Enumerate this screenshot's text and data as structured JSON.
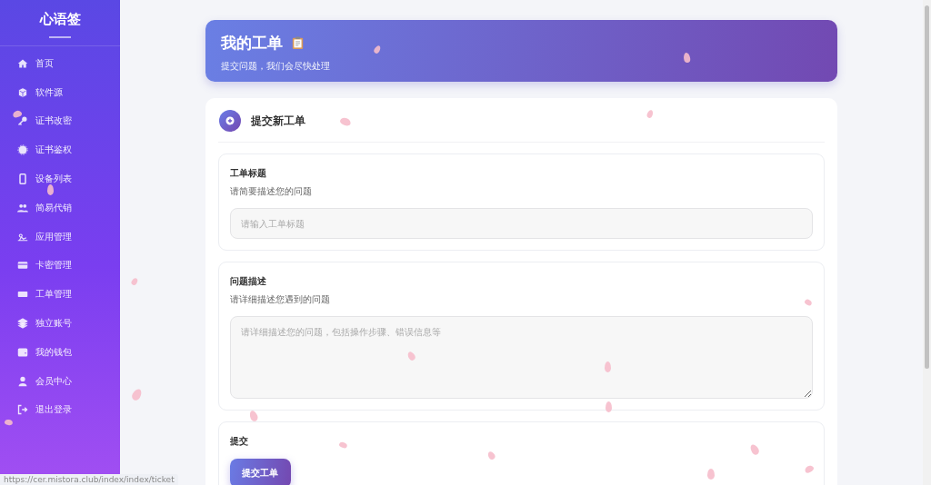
{
  "sidebar": {
    "brand": "心语签",
    "items": [
      {
        "label": "首页"
      },
      {
        "label": "软件源"
      },
      {
        "label": "证书改密"
      },
      {
        "label": "证书鉴权"
      },
      {
        "label": "设备列表"
      },
      {
        "label": "简易代销"
      },
      {
        "label": "应用管理"
      },
      {
        "label": "卡密管理"
      },
      {
        "label": "工单管理"
      },
      {
        "label": "独立账号"
      },
      {
        "label": "我的钱包"
      },
      {
        "label": "会员中心"
      },
      {
        "label": "退出登录"
      }
    ]
  },
  "header": {
    "title": "我的工单",
    "subtitle": "提交问题，我们会尽快处理"
  },
  "form": {
    "title": "提交新工单",
    "sections": [
      {
        "kind": "input",
        "label": "工单标题",
        "hint": "请简要描述您的问题",
        "placeholder": "请输入工单标题"
      },
      {
        "kind": "textarea",
        "label": "问题描述",
        "hint": "请详细描述您遇到的问题",
        "placeholder": "请详细描述您的问题，包括操作步骤、错误信息等"
      },
      {
        "kind": "submit",
        "label": "提交",
        "button": "提交工单"
      }
    ]
  },
  "status_bar": {
    "url": "https://cer.mistora.club/index/index/ticket"
  }
}
